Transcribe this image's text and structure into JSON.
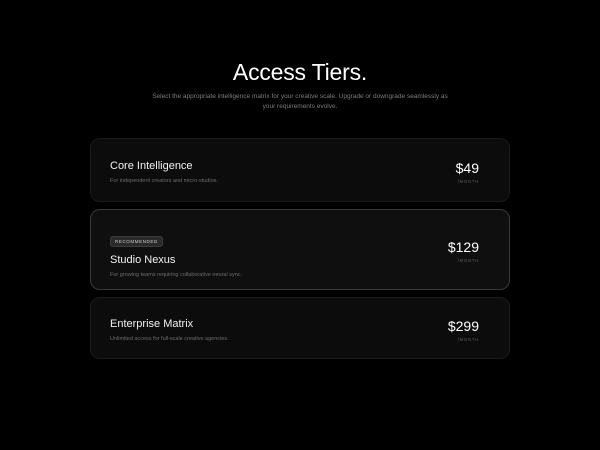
{
  "header": {
    "title": "Access Tiers.",
    "subtitle": "Select the appropriate intelligence matrix for your creative scale. Upgrade or downgrade seamlessly as your requirements evolve."
  },
  "tiers": [
    {
      "name": "Core Intelligence",
      "description": "For independent creators and micro-studios.",
      "price": "$49",
      "period": "/MONTH",
      "badge": null
    },
    {
      "name": "Studio Nexus",
      "description": "For growing teams requiring collaborative neural sync.",
      "price": "$129",
      "period": "/MONTH",
      "badge": "RECOMMENDED"
    },
    {
      "name": "Enterprise Matrix",
      "description": "Unlimited access for full-scale creative agencies.",
      "price": "$299",
      "period": "/MONTH",
      "badge": null
    }
  ],
  "colors": {
    "background": "#000000",
    "card": "#0c0c0c",
    "highlight_border": "#3a3a3a",
    "text_primary": "#ffffff",
    "text_muted": "#7c7c7c"
  }
}
